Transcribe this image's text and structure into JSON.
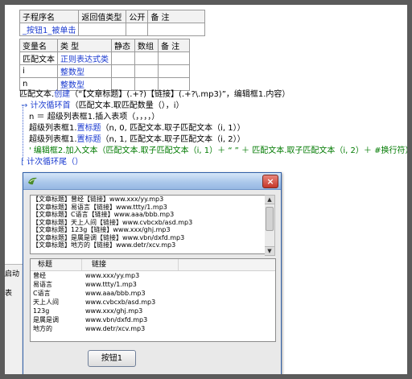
{
  "sub_table": {
    "headers": [
      "子程序名",
      "返回值类型",
      "公开",
      "备 注"
    ],
    "row": [
      "_按钮1_被单击",
      "",
      "",
      ""
    ]
  },
  "var_table": {
    "headers": [
      "变量名",
      "类 型",
      "静态",
      "数组",
      "备 注"
    ],
    "rows": [
      [
        "匹配文本",
        "正则表达式类",
        "",
        "",
        ""
      ],
      [
        "i",
        "整数型",
        "",
        "",
        ""
      ],
      [
        "n",
        "整数型",
        "",
        "",
        ""
      ]
    ]
  },
  "code": {
    "line1_a": "匹配文本.",
    "line1_b": "创建",
    "line1_c": "（“【文章标题】(.+?)【链接】(.+?\\.mp3)”，编辑框1.内容）",
    "line2_a": "计次循环首",
    "line2_b": "（匹配文本.取匹配数量（），i）",
    "line3": "n ＝ 超级列表框1.插入表项（，，，，）",
    "line4_a": "超级列表框1.",
    "line4_b": "置标题",
    "line4_c": "（n, 0, 匹配文本.取子匹配文本（i, 1））",
    "line5_a": "超级列表框1.",
    "line5_b": "置标题",
    "line5_c": "（n, 1, 匹配文本.取子匹配文本（i, 2））",
    "line6_a": "' 编辑框2.",
    "line6_b": "加入文本",
    "line6_c": "（匹配文本.取子匹配文本（i, 1）＋ “ ” ＋ 匹配文本.取子匹配文本（i, 2）＋ #换行符）",
    "line7": "计次循环尾（）"
  },
  "left_window": {
    "label1": "启动",
    "label2": "表"
  },
  "dialog": {
    "close": "×",
    "text_lines": [
      "【文章标题】曾经【链接】www.xxx/yy.mp3",
      "【文章标题】易语言【链接】www.ttty/1.mp3",
      "【文章标题】C语言【链接】www.aaa/bbb.mp3",
      "【文章标题】天上人间【链接】www.cvbcxb/asd.mp3",
      "【文章标题】123g【链接】www.xxx/ghj.mp3",
      "【文章标题】是属是调【链接】www.vbn/dxfd.mp3",
      "【文章标题】地方的【链接】www.detr/xcv.mp3"
    ],
    "list_headers": [
      "标题",
      "链接"
    ],
    "list_rows": [
      [
        "曾经",
        "www.xxx/yy.mp3"
      ],
      [
        "易语言",
        "www.ttty/1.mp3"
      ],
      [
        "C语言",
        "www.aaa/bbb.mp3"
      ],
      [
        "天上人间",
        "www.cvbcxb/asd.mp3"
      ],
      [
        "123g",
        "www.xxx/ghj.mp3"
      ],
      [
        "是属是调",
        "www.vbn/dxfd.mp3"
      ],
      [
        "地方的",
        "www.detr/xcv.mp3"
      ]
    ],
    "button": "按钮1"
  }
}
